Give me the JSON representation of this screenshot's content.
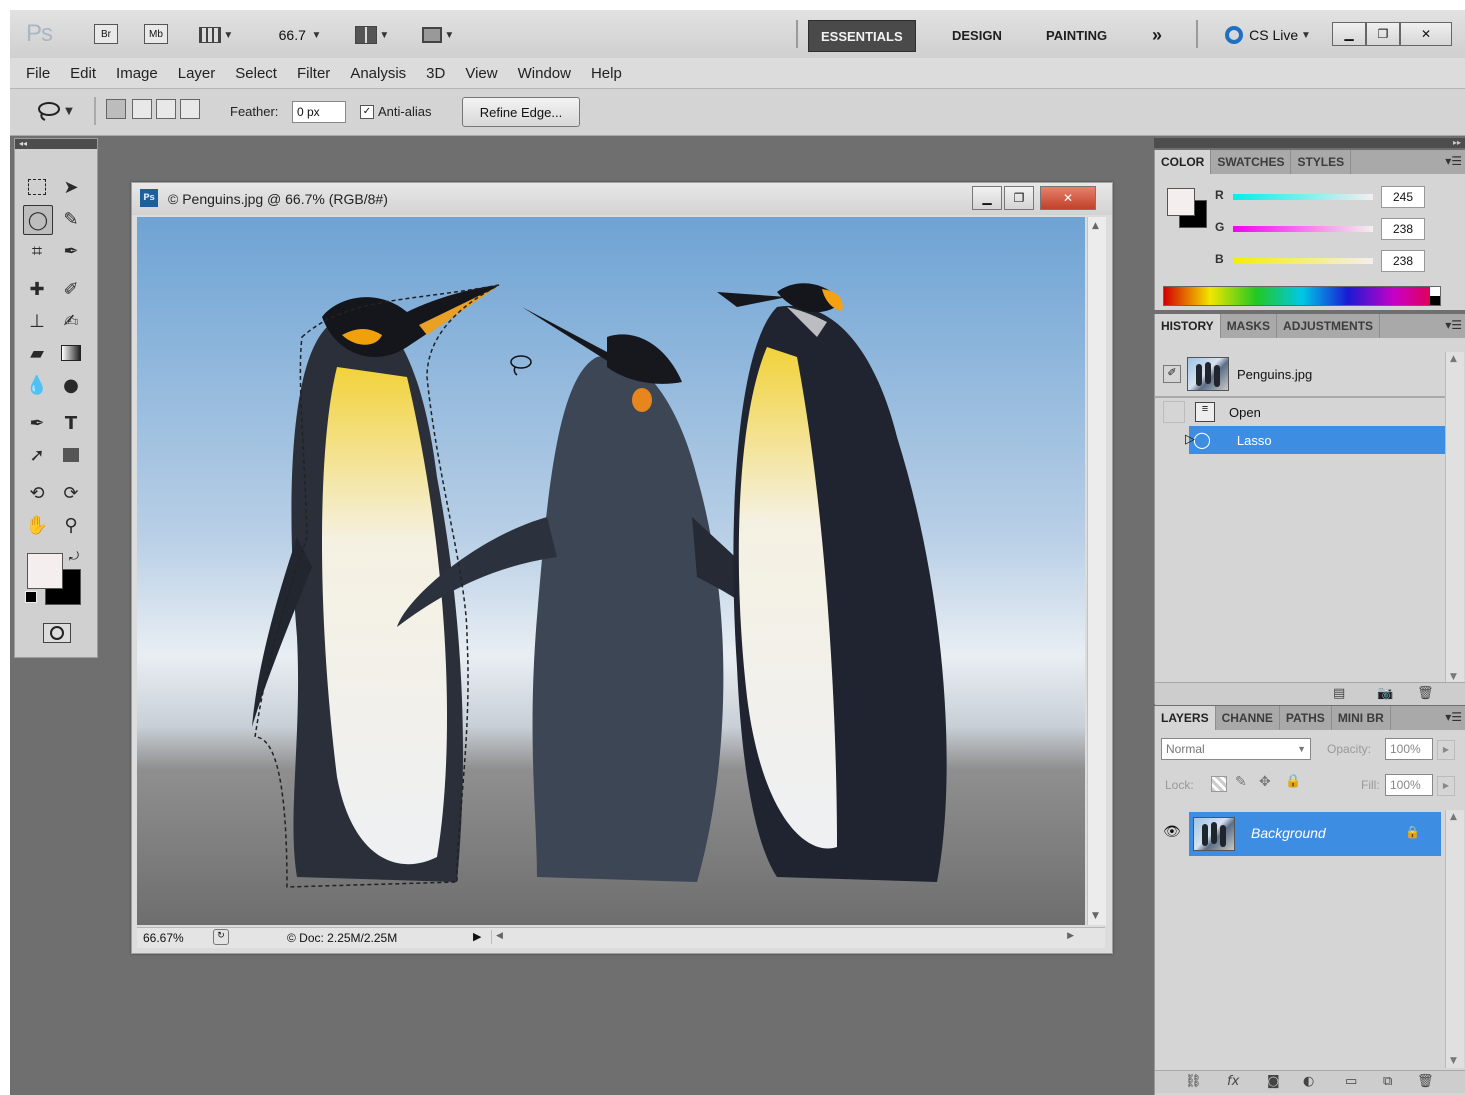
{
  "app": {
    "logo": "Ps",
    "bridge_label": "Br",
    "minibridge_label": "Mb",
    "zoom_value": "66.7",
    "workspaces": [
      "ESSENTIALS",
      "DESIGN",
      "PAINTING"
    ],
    "more_workspaces": "»",
    "cs_live": "CS Live"
  },
  "menu": [
    "File",
    "Edit",
    "Image",
    "Layer",
    "Select",
    "Filter",
    "Analysis",
    "3D",
    "View",
    "Window",
    "Help"
  ],
  "options": {
    "feather_label": "Feather:",
    "feather_value": "0 px",
    "antialias_label": "Anti-alias",
    "antialias_checked": true,
    "refine_edge_label": "Refine Edge..."
  },
  "document": {
    "title": "© Penguins.jpg @ 66.7% (RGB/8#)",
    "zoom_status": "66.67%",
    "doc_size": "© Doc: 2.25M/2.25M"
  },
  "color_panel": {
    "tabs": [
      "COLOR",
      "SWATCHES",
      "STYLES"
    ],
    "channels": [
      {
        "label": "R",
        "value": "245"
      },
      {
        "label": "G",
        "value": "238"
      },
      {
        "label": "B",
        "value": "238"
      }
    ],
    "foreground": "#f5eeee",
    "background": "#000000"
  },
  "history_panel": {
    "tabs": [
      "HISTORY",
      "MASKS",
      "ADJUSTMENTS"
    ],
    "snapshot": "Penguins.jpg",
    "states": [
      "Open",
      "Lasso"
    ],
    "selected_state": "Lasso"
  },
  "layers_panel": {
    "tabs": [
      "LAYERS",
      "CHANNE",
      "PATHS",
      "MINI BR"
    ],
    "blend_mode": "Normal",
    "opacity_label": "Opacity:",
    "opacity_value": "100%",
    "lock_label": "Lock:",
    "fill_label": "Fill:",
    "fill_value": "100%",
    "layers": [
      {
        "name": "Background",
        "locked": true,
        "visible": true
      }
    ]
  }
}
